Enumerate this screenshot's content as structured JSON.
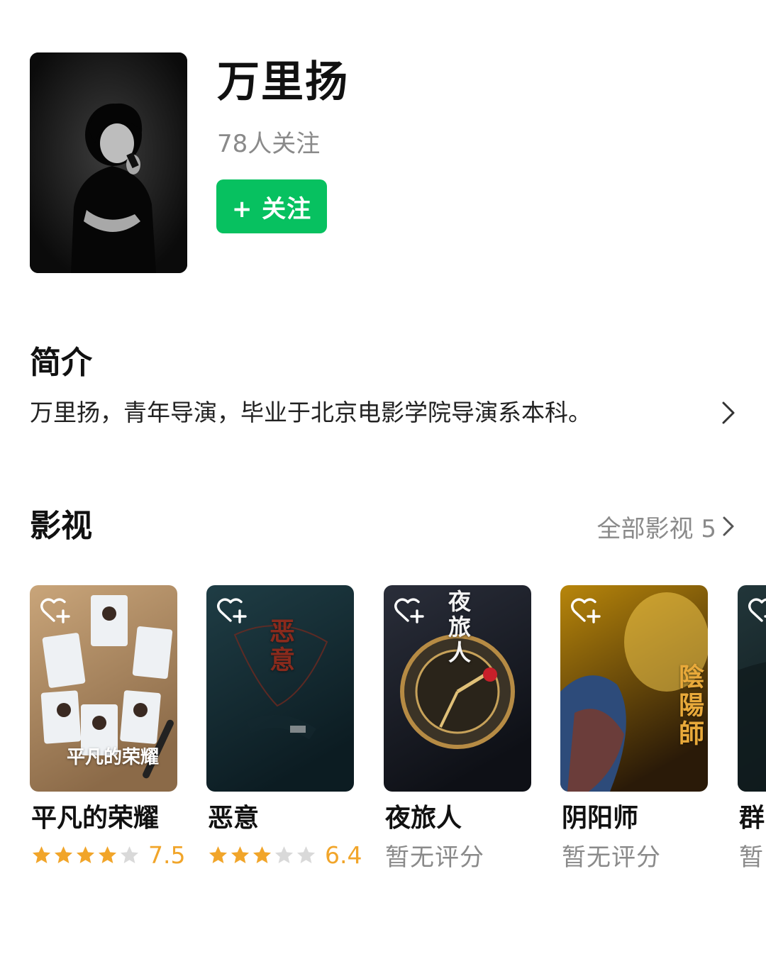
{
  "profile": {
    "name": "万里扬",
    "followers": "78人关注",
    "follow_button": "+ 关注"
  },
  "intro": {
    "title": "简介",
    "text": "万里扬，青年导演，毕业于北京电影学院导演系本科。"
  },
  "films": {
    "title": "影视",
    "all_label": "全部影视 5",
    "items": [
      {
        "title": "平凡的荣耀",
        "rating": 7.5,
        "rating_text": "7.5",
        "stars": 4,
        "poster_text": "平凡的荣耀",
        "poster_colors": [
          "#c9a57a",
          "#8b6a48"
        ]
      },
      {
        "title": "恶意",
        "rating": 6.4,
        "rating_text": "6.4",
        "stars": 3,
        "poster_text": "恶意",
        "poster_colors": [
          "#1f3d45",
          "#0c1c22"
        ]
      },
      {
        "title": "夜旅人",
        "rating_text": "暂无评分",
        "poster_text": "夜旅人",
        "poster_colors": [
          "#2a2e3a",
          "#0e1016"
        ]
      },
      {
        "title": "阴阳师",
        "rating_text": "暂无评分",
        "poster_text": "陰陽師",
        "poster_colors": [
          "#b8860b",
          "#2a1a08"
        ]
      },
      {
        "title": "群",
        "rating_text": "暂",
        "poster_colors": [
          "#22363a",
          "#0c1618"
        ]
      }
    ]
  },
  "colors": {
    "accent_green": "#07c160",
    "star_orange": "#f1a52a",
    "star_gray": "#d9d9d9",
    "muted_text": "#8a8a8a"
  },
  "icons": [
    "heart-plus-icon",
    "chevron-right-icon",
    "star-icon"
  ]
}
